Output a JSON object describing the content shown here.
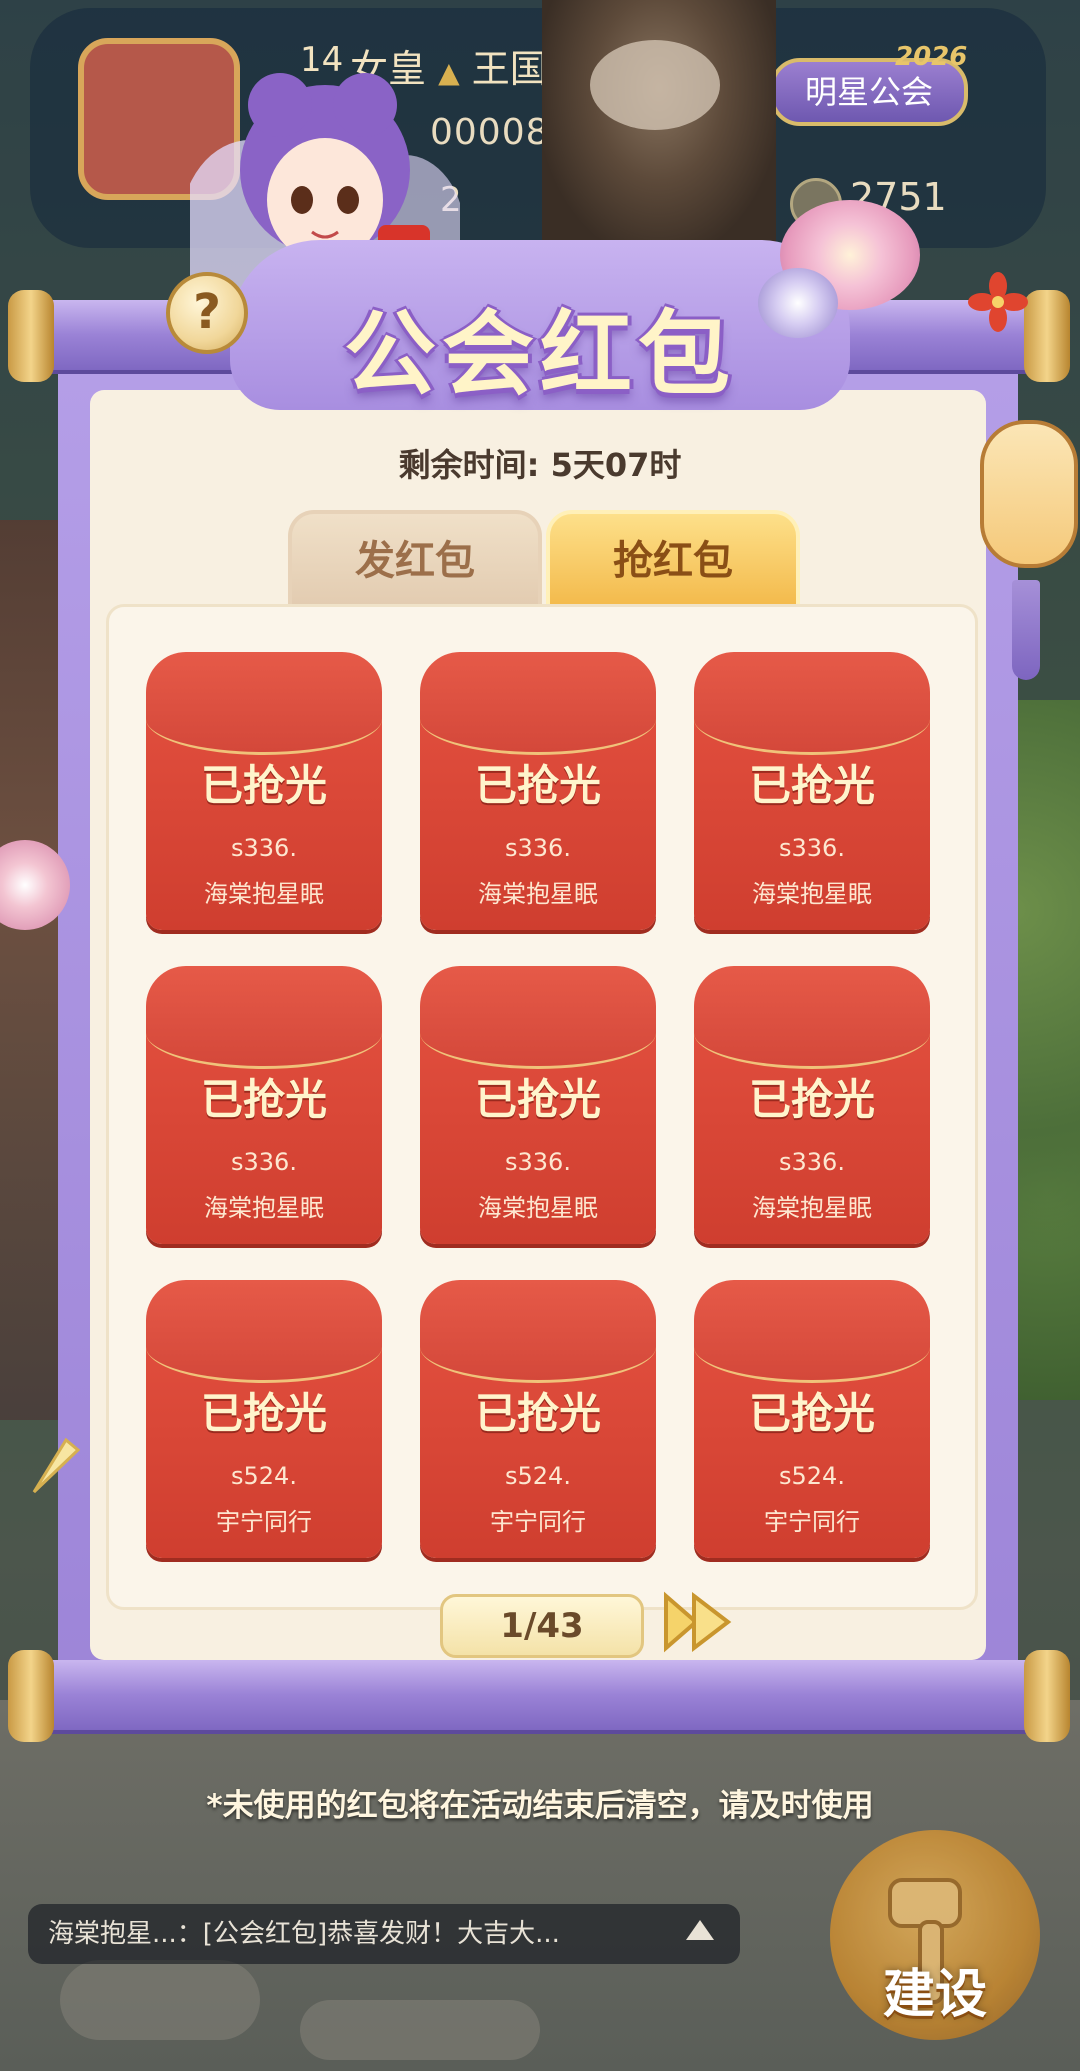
{
  "hud": {
    "level": "14",
    "player_name": "女皇",
    "name_suffix": "王国",
    "player_id": "00008",
    "second_value": "2",
    "guild_name": "明星公会",
    "year_badge": "2026",
    "coin_value": "2751"
  },
  "panel": {
    "title": "公会红包",
    "help_label": "?",
    "remaining_time": "剩余时间: 5天07时",
    "tabs": [
      {
        "label": "发红包",
        "selected": false
      },
      {
        "label": "抢红包",
        "selected": true
      }
    ],
    "envelopes": [
      {
        "status": "已抢光",
        "server": "s336.",
        "user": "海棠抱星眠"
      },
      {
        "status": "已抢光",
        "server": "s336.",
        "user": "海棠抱星眠"
      },
      {
        "status": "已抢光",
        "server": "s336.",
        "user": "海棠抱星眠"
      },
      {
        "status": "已抢光",
        "server": "s336.",
        "user": "海棠抱星眠"
      },
      {
        "status": "已抢光",
        "server": "s336.",
        "user": "海棠抱星眠"
      },
      {
        "status": "已抢光",
        "server": "s336.",
        "user": "海棠抱星眠"
      },
      {
        "status": "已抢光",
        "server": "s524.",
        "user": "宇宁同行"
      },
      {
        "status": "已抢光",
        "server": "s524.",
        "user": "宇宁同行"
      },
      {
        "status": "已抢光",
        "server": "s524.",
        "user": "宇宁同行"
      }
    ],
    "pager": "1/43"
  },
  "notice": "*未使用的红包将在活动结束后清空，请及时使用",
  "chat": {
    "message": "海棠抱星...：[公会红包]恭喜发财！大吉大..."
  },
  "build_button": {
    "label": "建设"
  },
  "colors": {
    "envelope_red": "#d9463a",
    "panel_purple": "#a88ee0",
    "paper": "#f8f0e1",
    "tab_active": "#f3b94a"
  },
  "icons": [
    "help-icon",
    "coin-icon",
    "next-page-icon",
    "chat-expand-icon",
    "hammer-icon",
    "lantern-icon"
  ]
}
